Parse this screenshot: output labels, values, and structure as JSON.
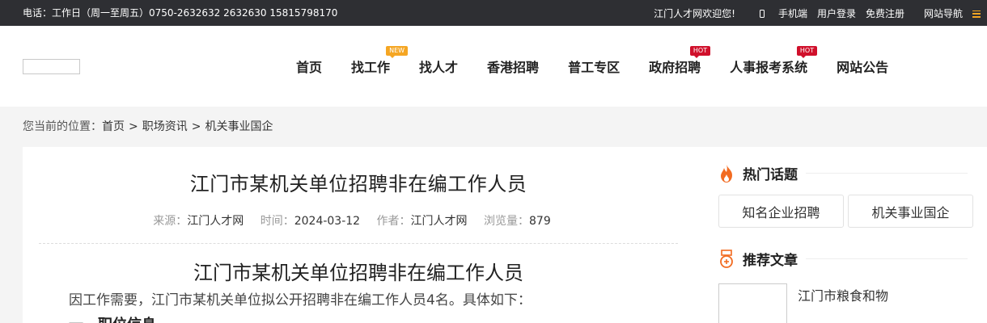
{
  "topbar": {
    "contact": "电话：工作日（周一至周五）0750-2632632 2632630 15815798170",
    "welcome": "江门人才网欢迎您!",
    "mobile": "手机端",
    "login": "用户登录",
    "register": "免费注册",
    "site_nav": "网站导航"
  },
  "nav": {
    "items": [
      {
        "label": "首页"
      },
      {
        "label": "找工作",
        "badge": "NEW"
      },
      {
        "label": "找人才"
      },
      {
        "label": "香港招聘"
      },
      {
        "label": "普工专区"
      },
      {
        "label": "政府招聘",
        "badge": "HOT"
      },
      {
        "label": "人事报考系统",
        "badge": "HOT"
      },
      {
        "label": "网站公告"
      }
    ]
  },
  "breadcrumb": {
    "prefix": "您当前的位置：",
    "items": [
      "首页",
      "职场资讯",
      "机关事业国企"
    ],
    "separator": ">"
  },
  "article": {
    "title": "江门市某机关单位招聘非在编工作人员",
    "meta": {
      "source_label": "来源：",
      "source": "江门人才网",
      "time_label": "时间：",
      "time": "2024-03-12",
      "author_label": "作者：",
      "author": "江门人才网",
      "views_label": "浏览量：",
      "views": "879"
    },
    "subtitle": "江门市某机关单位招聘非在编工作人员",
    "intro": "因工作需要，江门市某机关单位拟公开招聘非在编工作人员4名。具体如下：",
    "section1": "一、职位信息"
  },
  "sidebar": {
    "hot_title": "热门话题",
    "tags": [
      "知名企业招聘",
      "机关事业国企"
    ],
    "rec_title": "推荐文章",
    "rec_items": [
      {
        "title": "江门市粮食和物"
      }
    ]
  },
  "colors": {
    "topbar_bg": "#2e2f33",
    "accent_orange": "#f5a623",
    "hot_red": "#d0102b",
    "flame": "#f26b21"
  }
}
